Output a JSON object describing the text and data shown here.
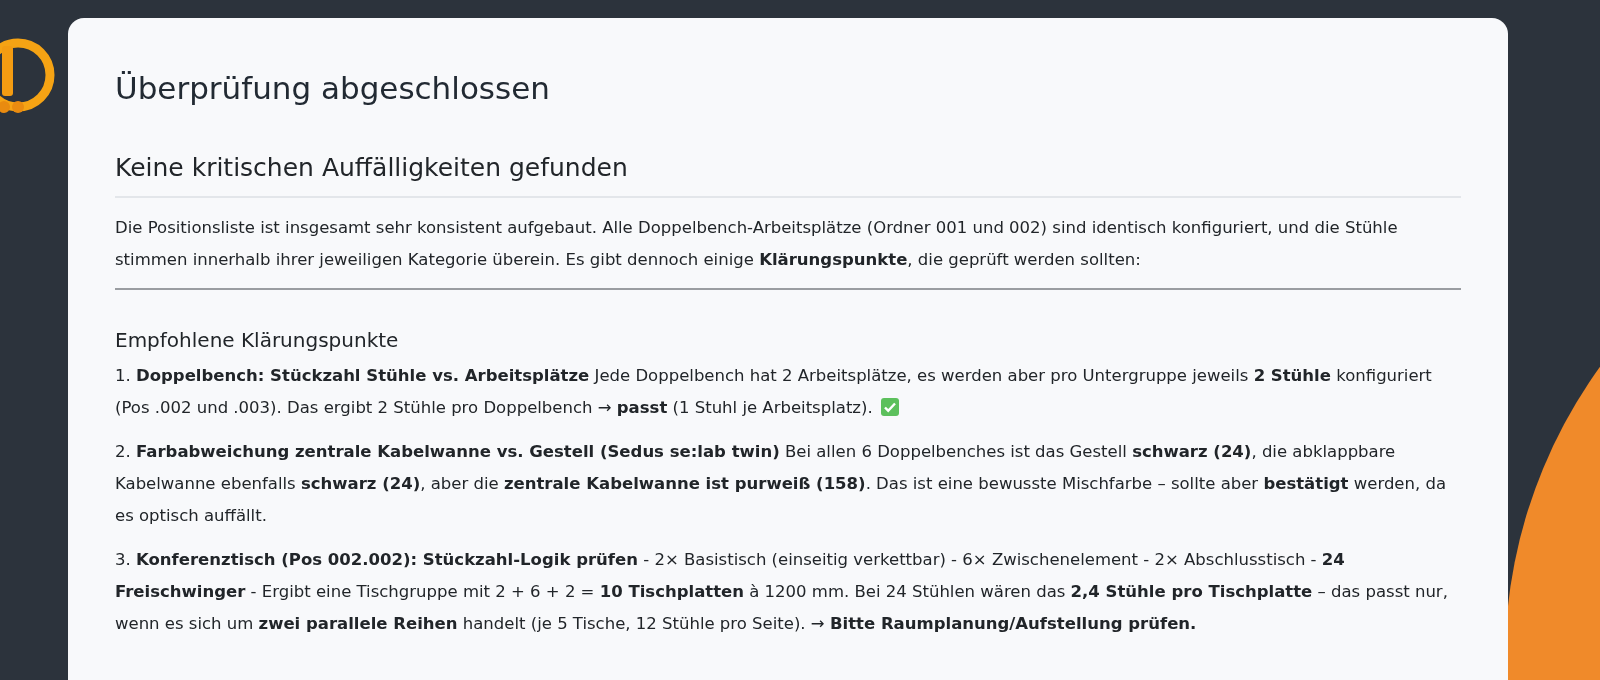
{
  "title": "Überprüfung abgeschlossen",
  "summary": {
    "heading": "Keine kritischen Auffälligkeiten gefunden",
    "text": "Die Positionsliste ist insgesamt sehr konsistent aufgebaut. Alle Doppelbench-Arbeitsplätze (Ordner 001 und 002) sind identisch konfiguriert, und die Stühle stimmen innerhalb ihrer jeweiligen Kategorie überein. Es gibt dennoch einige **Klärungspunkte**, die geprüft werden sollten:"
  },
  "section": {
    "heading": "Empfohlene Klärungspunkte",
    "items": [
      {
        "text": "1. **Doppelbench: Stückzahl Stühle vs. Arbeitsplätze** Jede Doppelbench hat 2 Arbeitsplätze, es werden aber pro Untergruppe jeweils **2 Stühle** konfiguriert (Pos .002 und .003). Das ergibt 2 Stühle pro Doppelbench → **passt** (1 Stuhl je Arbeitsplatz).",
        "checked": true
      },
      {
        "text": "2. **Farbabweichung zentrale Kabelwanne vs. Gestell (Sedus se:lab twin)** Bei allen 6 Doppelbenches ist das Gestell **schwarz (24)**, die abklappbare Kabelwanne ebenfalls **schwarz (24)**, aber die **zentrale Kabelwanne ist purweiß (158)**. Das ist eine bewusste Mischfarbe – sollte aber **bestätigt** werden, da es optisch auffällt.",
        "checked": false
      },
      {
        "text": "3. **Konferenztisch (Pos 002.002): Stückzahl-Logik prüfen** - 2× Basistisch (einseitig verkettbar) - 6× Zwischenelement - 2× Abschlusstisch - **24 Freischwinger** - Ergibt eine Tischgruppe mit 2 + 6 + 2 = **10 Tischplatten** à 1200 mm. Bei 24 Stühlen wären das **2,4 Stühle pro Tischplatte** – das passt nur, wenn es sich um **zwei parallele Reihen** handelt (je 5 Tische, 12 Stühle pro Seite). → **Bitte Raumplanung/Aufstellung prüfen.**",
        "checked": false
      }
    ]
  }
}
